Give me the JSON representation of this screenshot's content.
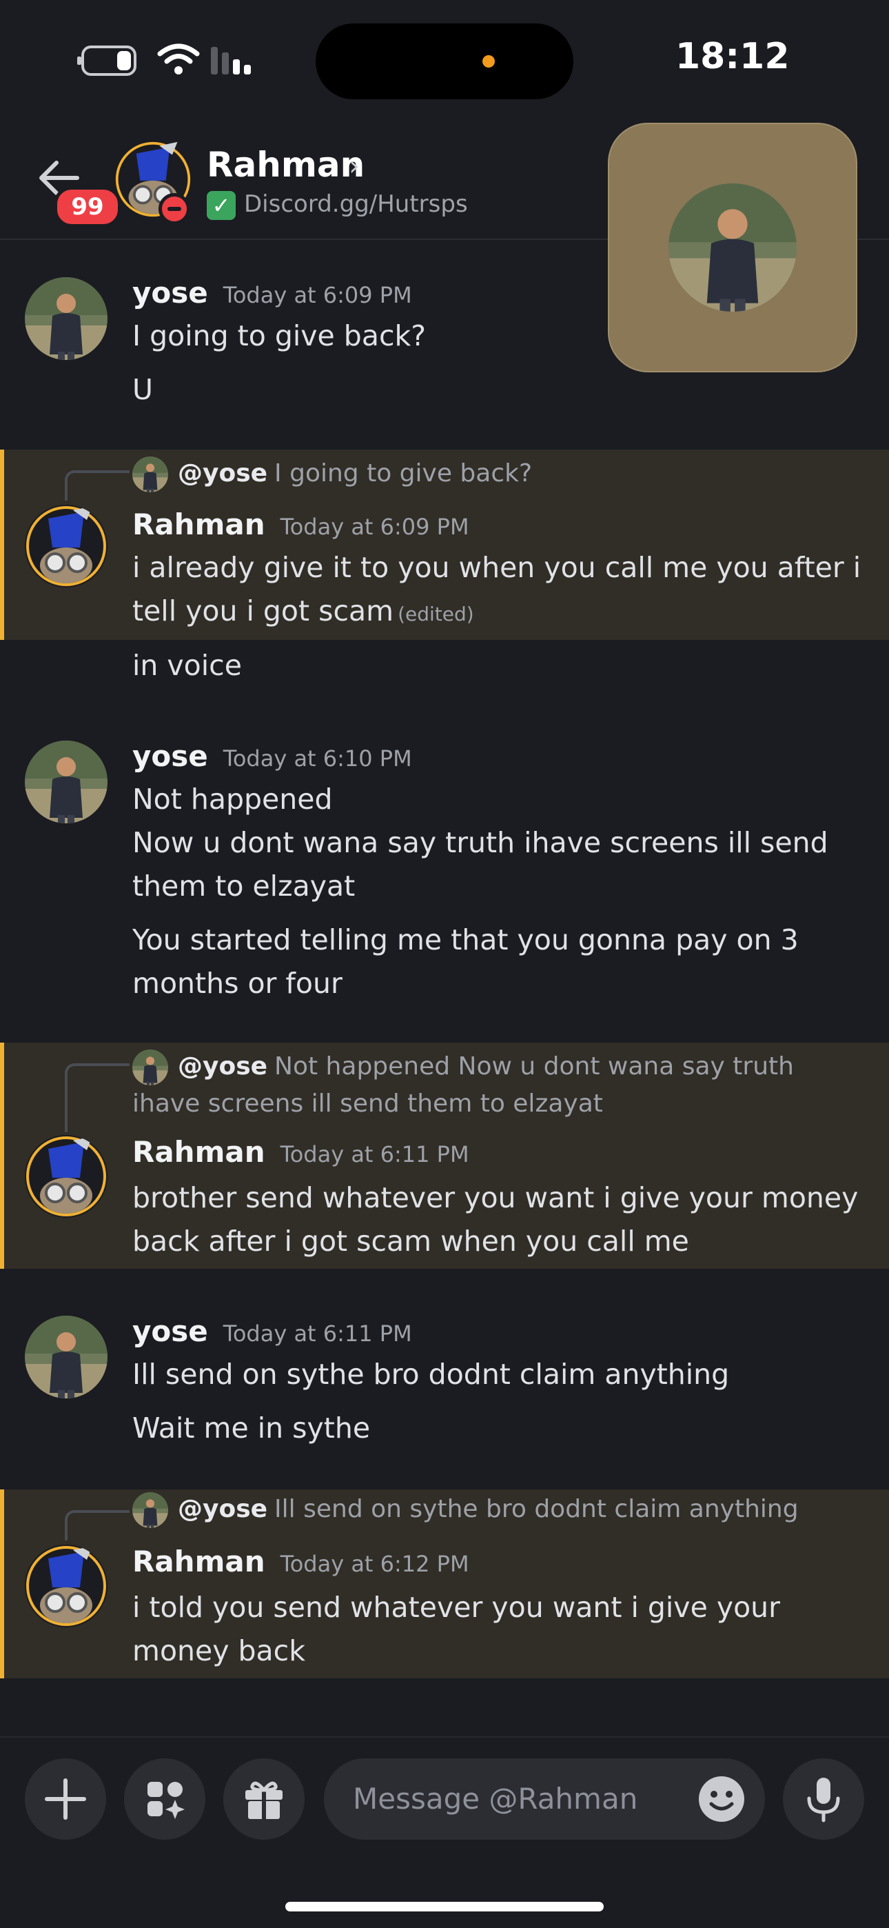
{
  "status_bar": {
    "time": "18:12"
  },
  "header": {
    "unread_badge": "99",
    "name": "Rahman",
    "chevron": "›",
    "status_text": "Discord.gg/Hutrsps"
  },
  "messages": [
    {
      "author": "yose",
      "timestamp": "Today at 6:09 PM",
      "lines": [
        "I going to give back?",
        "U"
      ]
    },
    {
      "reply_to": "@yose",
      "reply_text": "I going to give back?",
      "author": "Rahman",
      "timestamp": "Today at 6:09 PM",
      "lines": [
        "i already give it to you when you  call me you after i tell you i got scam",
        "in voice"
      ],
      "edited": "(edited)"
    },
    {
      "author": "yose",
      "timestamp": "Today at 6:10 PM",
      "lines": [
        "Not happened",
        "Now u dont wana say truth ihave screens ill send them to elzayat",
        "You started telling me that you gonna pay on 3 months or four"
      ]
    },
    {
      "reply_to": "@yose",
      "reply_text": "Not happened  Now u dont wana say truth ihave screens ill send them to elzayat",
      "author": "Rahman",
      "timestamp": "Today at 6:11 PM",
      "lines": [
        "brother send whatever you want i give your money back after i got scam when you call me"
      ]
    },
    {
      "author": "yose",
      "timestamp": "Today at 6:11 PM",
      "lines": [
        "Ill send on sythe bro dodnt claim anything",
        "Wait me in sythe"
      ]
    },
    {
      "reply_to": "@yose",
      "reply_text": "Ill send on sythe bro dodnt claim anything",
      "author": "Rahman",
      "timestamp": "Today at 6:12 PM",
      "lines": [
        "i told you send whatever you want i give your money back"
      ]
    }
  ],
  "composer": {
    "placeholder": "Message @Rahman"
  }
}
